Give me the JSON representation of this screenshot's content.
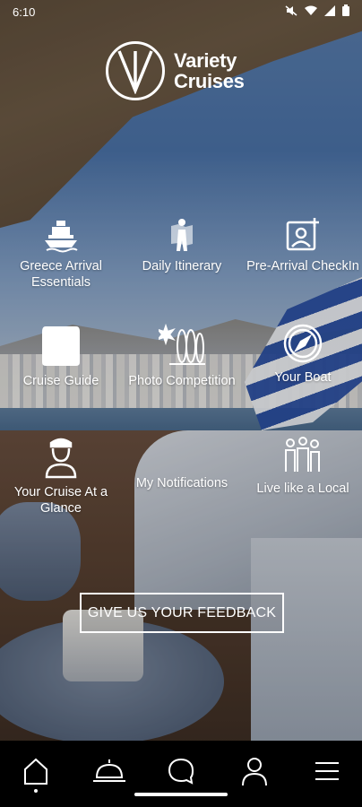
{
  "status_bar": {
    "time": "6:10"
  },
  "logo": {
    "line1": "Variety",
    "line2": "Cruises"
  },
  "tiles": [
    {
      "label": "Greece Arrival Essentials",
      "icon": "ship-icon"
    },
    {
      "label": "Daily Itinerary",
      "icon": "map-person-icon"
    },
    {
      "label": "Pre-Arrival CheckIn",
      "icon": "add-photo-icon"
    },
    {
      "label": "Cruise Guide",
      "icon": "guide-book-icon"
    },
    {
      "label": "Photo Competition",
      "icon": "surfboard-icon"
    },
    {
      "label": "Your Boat",
      "icon": "compass-icon"
    },
    {
      "label": "Your Cruise At a Glance",
      "icon": "captain-icon"
    },
    {
      "label": "My Notifications",
      "icon": "notification-icon"
    },
    {
      "label": "Live like a Local",
      "icon": "people-icon"
    }
  ],
  "feedback_button": {
    "label": "GIVE US YOUR FEEDBACK"
  },
  "bottom_nav": [
    {
      "name": "home",
      "icon": "home-icon"
    },
    {
      "name": "services",
      "icon": "cloche-icon"
    },
    {
      "name": "chat",
      "icon": "chat-icon"
    },
    {
      "name": "profile",
      "icon": "person-icon"
    },
    {
      "name": "menu",
      "icon": "menu-icon"
    }
  ]
}
